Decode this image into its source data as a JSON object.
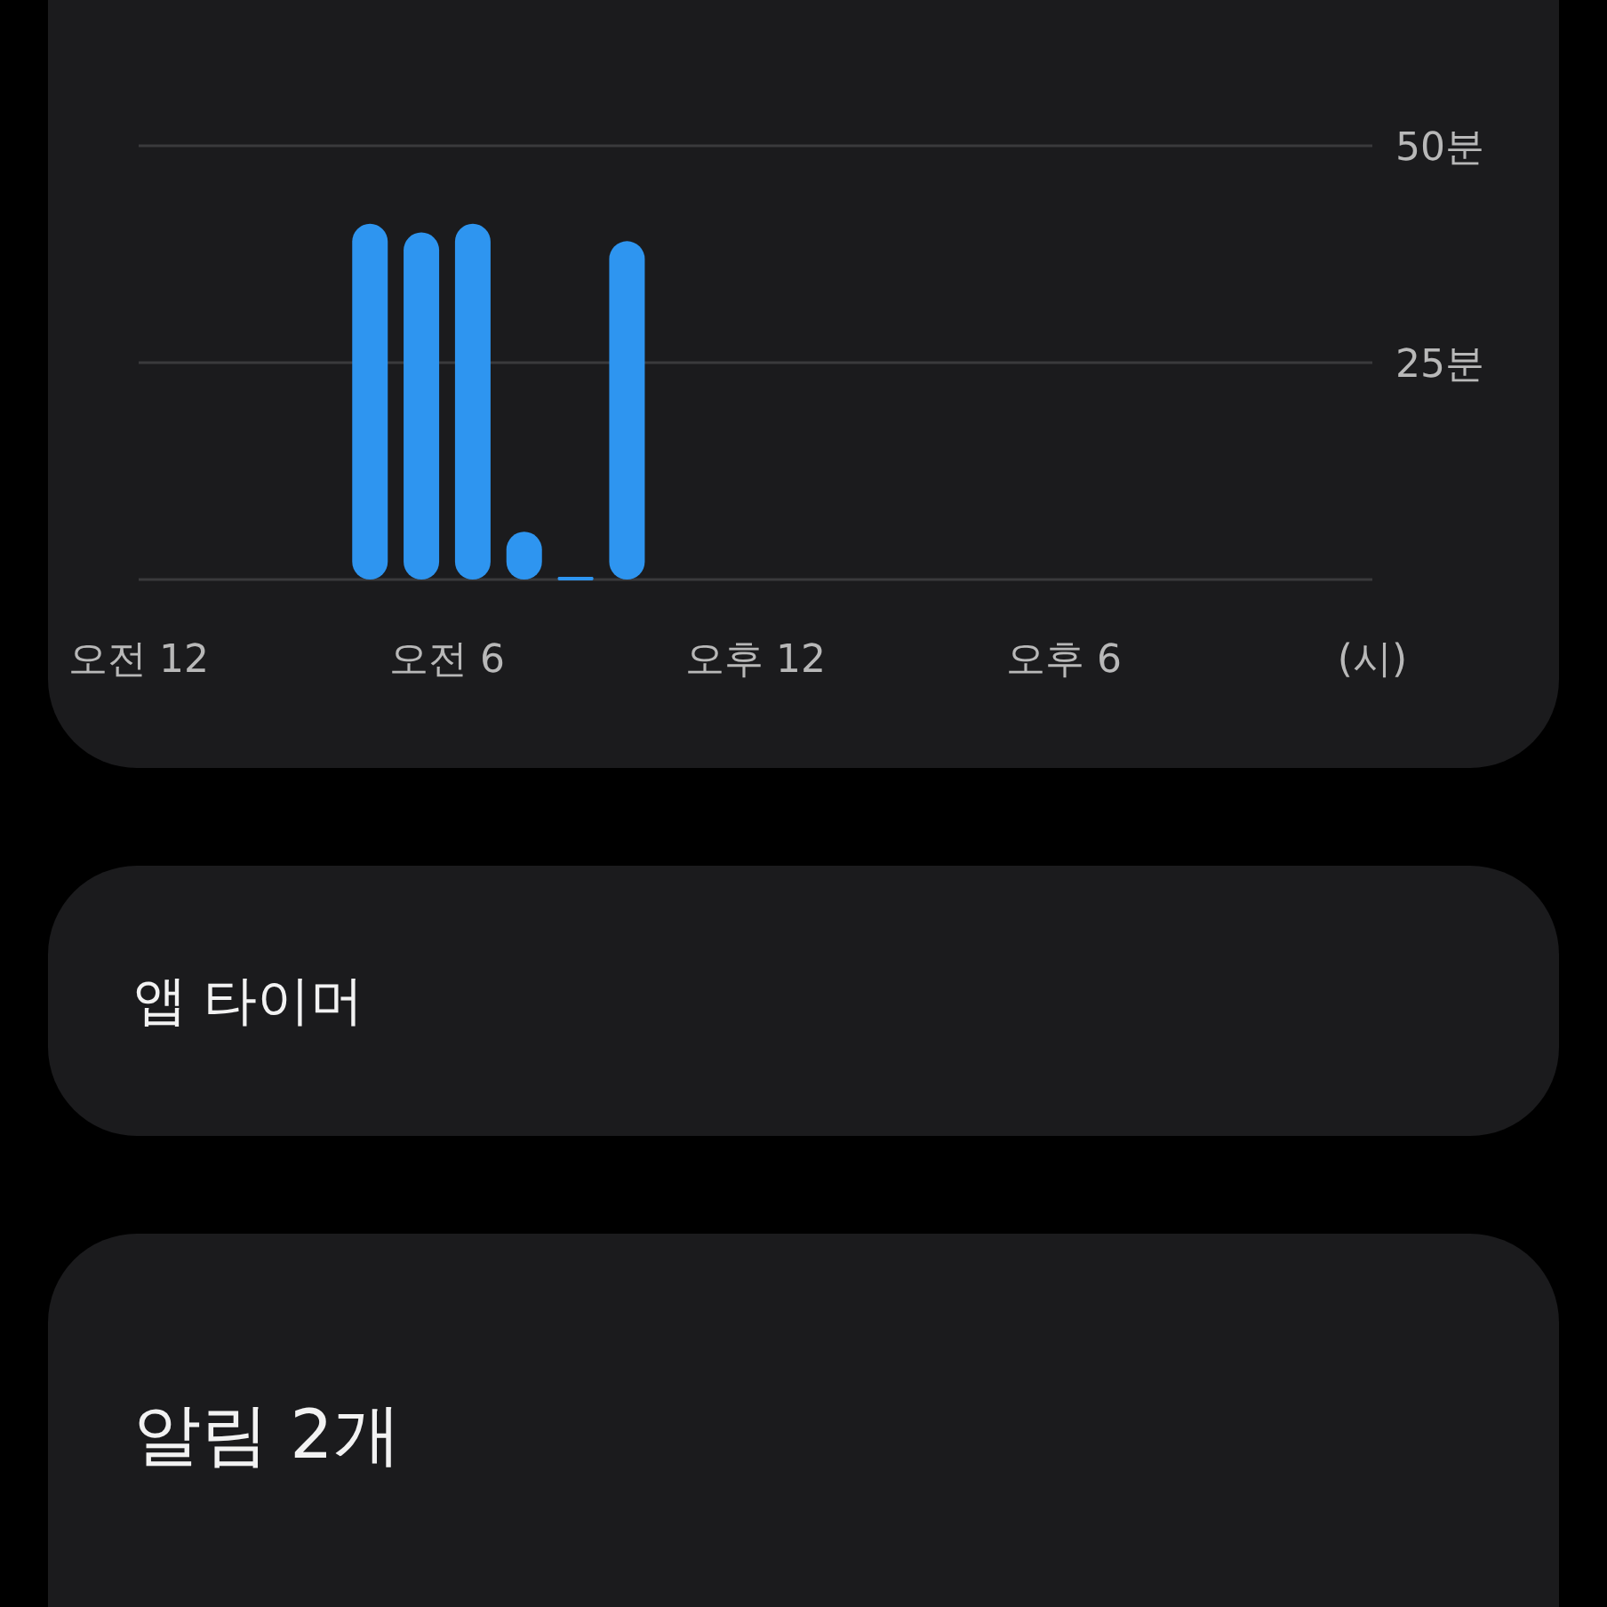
{
  "usage_card": {
    "chart_data": {
      "type": "bar",
      "xlabel": "(시)",
      "categories": [
        "오전 12",
        null,
        null,
        null,
        null,
        null,
        "오전 6",
        null,
        null,
        null,
        null,
        null,
        "오후 12",
        null,
        null,
        null,
        null,
        null,
        "오후 6",
        null,
        null,
        null,
        null,
        null
      ],
      "series": [
        {
          "color": "#2e95f0",
          "values": [
            0,
            0,
            0,
            0,
            41,
            40,
            41,
            5.5,
            0.3,
            39,
            0,
            0,
            0,
            0,
            0,
            0,
            0,
            0,
            0,
            0,
            0,
            0,
            0,
            0
          ]
        }
      ],
      "ylim": [
        0,
        50
      ],
      "yticks": [
        {
          "value": 25,
          "label": "25분"
        },
        {
          "value": 50,
          "label": "50분"
        }
      ]
    }
  },
  "app_timer_card": {
    "title": "앱 타이머"
  },
  "notifications_card": {
    "title": "알림 2개"
  }
}
